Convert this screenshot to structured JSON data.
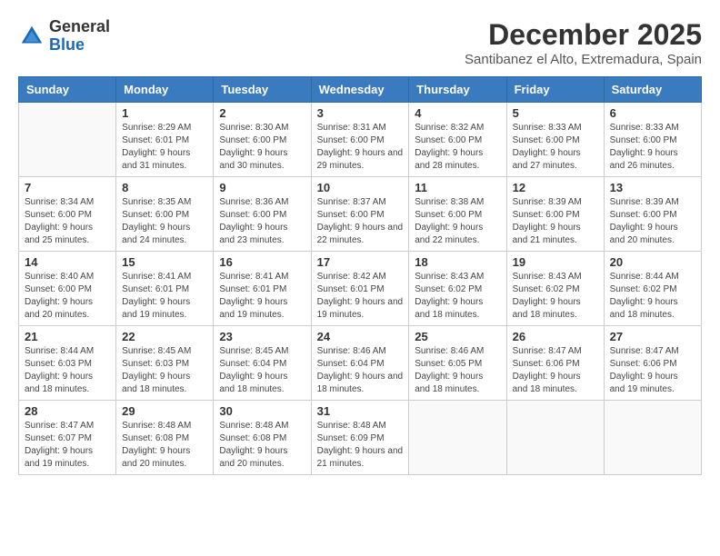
{
  "logo": {
    "general": "General",
    "blue": "Blue"
  },
  "title": "December 2025",
  "location": "Santibanez el Alto, Extremadura, Spain",
  "days_of_week": [
    "Sunday",
    "Monday",
    "Tuesday",
    "Wednesday",
    "Thursday",
    "Friday",
    "Saturday"
  ],
  "weeks": [
    [
      {
        "day": "",
        "sunrise": "",
        "sunset": "",
        "daylight": ""
      },
      {
        "day": "1",
        "sunrise": "Sunrise: 8:29 AM",
        "sunset": "Sunset: 6:01 PM",
        "daylight": "Daylight: 9 hours and 31 minutes."
      },
      {
        "day": "2",
        "sunrise": "Sunrise: 8:30 AM",
        "sunset": "Sunset: 6:00 PM",
        "daylight": "Daylight: 9 hours and 30 minutes."
      },
      {
        "day": "3",
        "sunrise": "Sunrise: 8:31 AM",
        "sunset": "Sunset: 6:00 PM",
        "daylight": "Daylight: 9 hours and 29 minutes."
      },
      {
        "day": "4",
        "sunrise": "Sunrise: 8:32 AM",
        "sunset": "Sunset: 6:00 PM",
        "daylight": "Daylight: 9 hours and 28 minutes."
      },
      {
        "day": "5",
        "sunrise": "Sunrise: 8:33 AM",
        "sunset": "Sunset: 6:00 PM",
        "daylight": "Daylight: 9 hours and 27 minutes."
      },
      {
        "day": "6",
        "sunrise": "Sunrise: 8:33 AM",
        "sunset": "Sunset: 6:00 PM",
        "daylight": "Daylight: 9 hours and 26 minutes."
      }
    ],
    [
      {
        "day": "7",
        "sunrise": "Sunrise: 8:34 AM",
        "sunset": "Sunset: 6:00 PM",
        "daylight": "Daylight: 9 hours and 25 minutes."
      },
      {
        "day": "8",
        "sunrise": "Sunrise: 8:35 AM",
        "sunset": "Sunset: 6:00 PM",
        "daylight": "Daylight: 9 hours and 24 minutes."
      },
      {
        "day": "9",
        "sunrise": "Sunrise: 8:36 AM",
        "sunset": "Sunset: 6:00 PM",
        "daylight": "Daylight: 9 hours and 23 minutes."
      },
      {
        "day": "10",
        "sunrise": "Sunrise: 8:37 AM",
        "sunset": "Sunset: 6:00 PM",
        "daylight": "Daylight: 9 hours and 22 minutes."
      },
      {
        "day": "11",
        "sunrise": "Sunrise: 8:38 AM",
        "sunset": "Sunset: 6:00 PM",
        "daylight": "Daylight: 9 hours and 22 minutes."
      },
      {
        "day": "12",
        "sunrise": "Sunrise: 8:39 AM",
        "sunset": "Sunset: 6:00 PM",
        "daylight": "Daylight: 9 hours and 21 minutes."
      },
      {
        "day": "13",
        "sunrise": "Sunrise: 8:39 AM",
        "sunset": "Sunset: 6:00 PM",
        "daylight": "Daylight: 9 hours and 20 minutes."
      }
    ],
    [
      {
        "day": "14",
        "sunrise": "Sunrise: 8:40 AM",
        "sunset": "Sunset: 6:00 PM",
        "daylight": "Daylight: 9 hours and 20 minutes."
      },
      {
        "day": "15",
        "sunrise": "Sunrise: 8:41 AM",
        "sunset": "Sunset: 6:01 PM",
        "daylight": "Daylight: 9 hours and 19 minutes."
      },
      {
        "day": "16",
        "sunrise": "Sunrise: 8:41 AM",
        "sunset": "Sunset: 6:01 PM",
        "daylight": "Daylight: 9 hours and 19 minutes."
      },
      {
        "day": "17",
        "sunrise": "Sunrise: 8:42 AM",
        "sunset": "Sunset: 6:01 PM",
        "daylight": "Daylight: 9 hours and 19 minutes."
      },
      {
        "day": "18",
        "sunrise": "Sunrise: 8:43 AM",
        "sunset": "Sunset: 6:02 PM",
        "daylight": "Daylight: 9 hours and 18 minutes."
      },
      {
        "day": "19",
        "sunrise": "Sunrise: 8:43 AM",
        "sunset": "Sunset: 6:02 PM",
        "daylight": "Daylight: 9 hours and 18 minutes."
      },
      {
        "day": "20",
        "sunrise": "Sunrise: 8:44 AM",
        "sunset": "Sunset: 6:02 PM",
        "daylight": "Daylight: 9 hours and 18 minutes."
      }
    ],
    [
      {
        "day": "21",
        "sunrise": "Sunrise: 8:44 AM",
        "sunset": "Sunset: 6:03 PM",
        "daylight": "Daylight: 9 hours and 18 minutes."
      },
      {
        "day": "22",
        "sunrise": "Sunrise: 8:45 AM",
        "sunset": "Sunset: 6:03 PM",
        "daylight": "Daylight: 9 hours and 18 minutes."
      },
      {
        "day": "23",
        "sunrise": "Sunrise: 8:45 AM",
        "sunset": "Sunset: 6:04 PM",
        "daylight": "Daylight: 9 hours and 18 minutes."
      },
      {
        "day": "24",
        "sunrise": "Sunrise: 8:46 AM",
        "sunset": "Sunset: 6:04 PM",
        "daylight": "Daylight: 9 hours and 18 minutes."
      },
      {
        "day": "25",
        "sunrise": "Sunrise: 8:46 AM",
        "sunset": "Sunset: 6:05 PM",
        "daylight": "Daylight: 9 hours and 18 minutes."
      },
      {
        "day": "26",
        "sunrise": "Sunrise: 8:47 AM",
        "sunset": "Sunset: 6:06 PM",
        "daylight": "Daylight: 9 hours and 18 minutes."
      },
      {
        "day": "27",
        "sunrise": "Sunrise: 8:47 AM",
        "sunset": "Sunset: 6:06 PM",
        "daylight": "Daylight: 9 hours and 19 minutes."
      }
    ],
    [
      {
        "day": "28",
        "sunrise": "Sunrise: 8:47 AM",
        "sunset": "Sunset: 6:07 PM",
        "daylight": "Daylight: 9 hours and 19 minutes."
      },
      {
        "day": "29",
        "sunrise": "Sunrise: 8:48 AM",
        "sunset": "Sunset: 6:08 PM",
        "daylight": "Daylight: 9 hours and 20 minutes."
      },
      {
        "day": "30",
        "sunrise": "Sunrise: 8:48 AM",
        "sunset": "Sunset: 6:08 PM",
        "daylight": "Daylight: 9 hours and 20 minutes."
      },
      {
        "day": "31",
        "sunrise": "Sunrise: 8:48 AM",
        "sunset": "Sunset: 6:09 PM",
        "daylight": "Daylight: 9 hours and 21 minutes."
      },
      {
        "day": "",
        "sunrise": "",
        "sunset": "",
        "daylight": ""
      },
      {
        "day": "",
        "sunrise": "",
        "sunset": "",
        "daylight": ""
      },
      {
        "day": "",
        "sunrise": "",
        "sunset": "",
        "daylight": ""
      }
    ]
  ]
}
